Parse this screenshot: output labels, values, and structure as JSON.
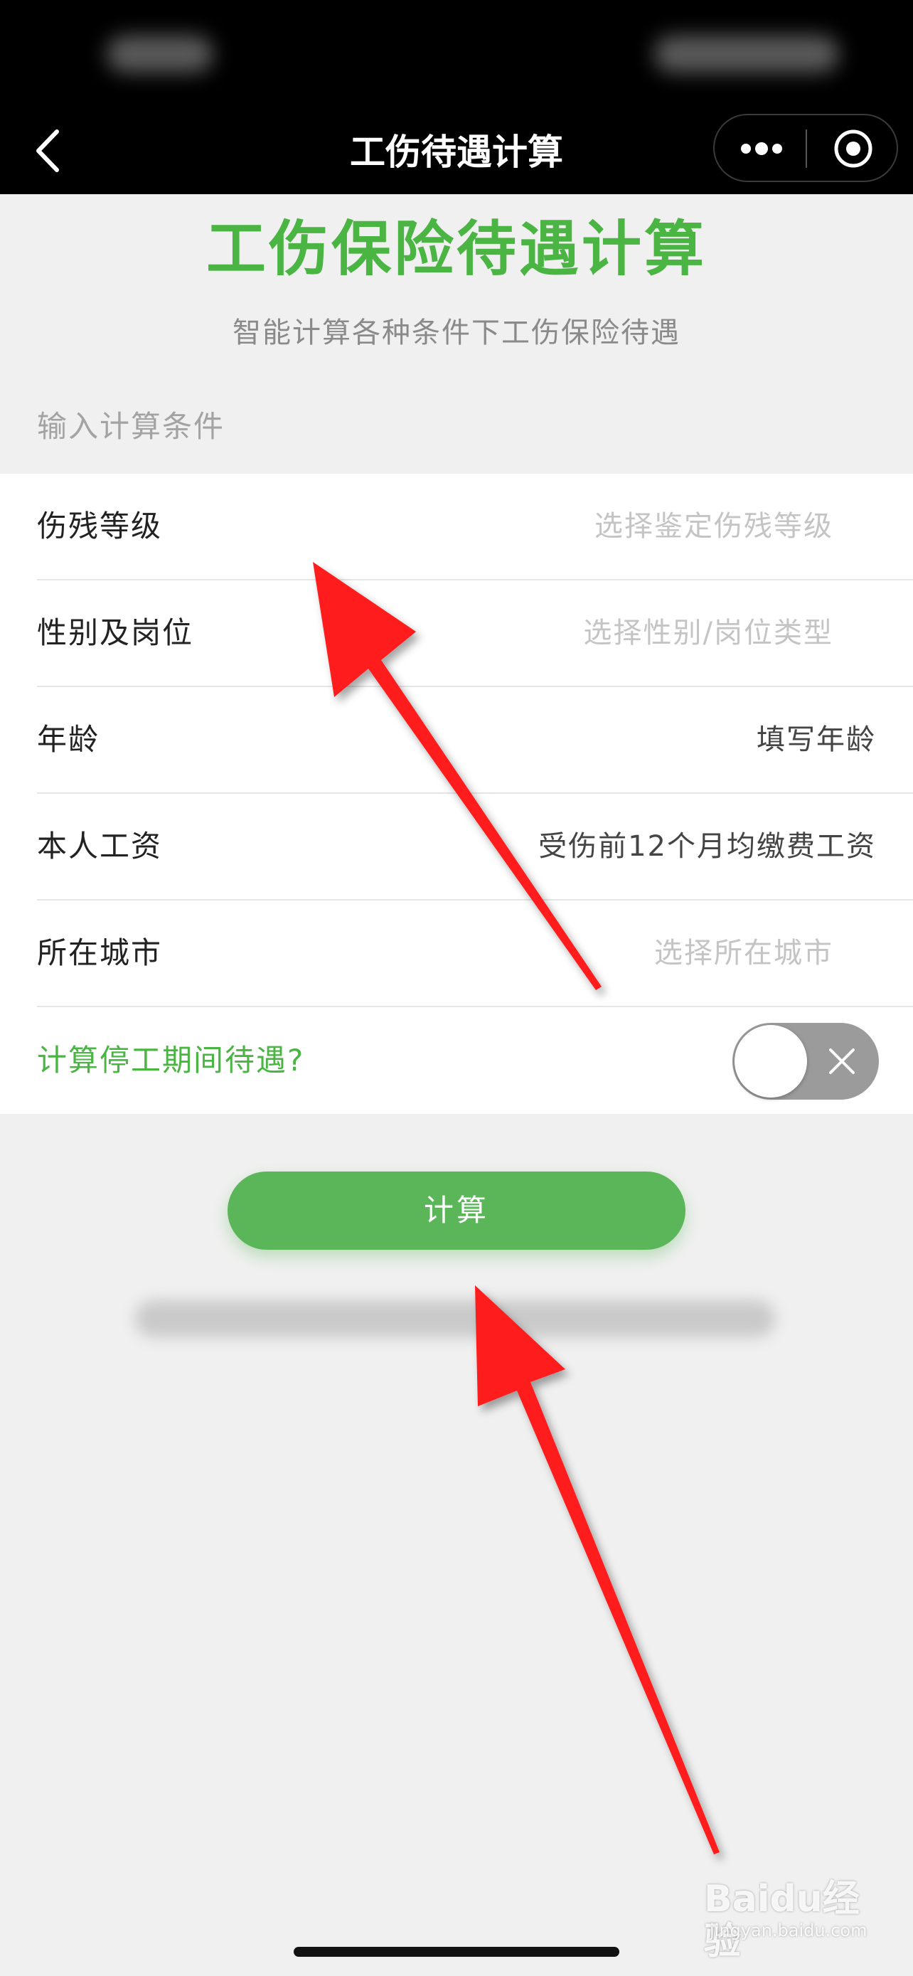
{
  "nav": {
    "title": "工伤待遇计算"
  },
  "header": {
    "title": "工伤保险待遇计算",
    "subtitle": "智能计算各种条件下工伤保险待遇"
  },
  "form": {
    "section_label": "输入计算条件",
    "rows": [
      {
        "label": "伤残等级",
        "value": "选择鉴定伤残等级"
      },
      {
        "label": "性别及岗位",
        "value": "选择性别/岗位类型"
      },
      {
        "label": "年龄",
        "value": "填写年龄"
      },
      {
        "label": "本人工资",
        "value": "受伤前12个月均缴费工资"
      },
      {
        "label": "所在城市",
        "value": "选择所在城市"
      }
    ],
    "toggle_label": "计算停工期间待遇?",
    "toggle_on": false
  },
  "actions": {
    "calculate_label": "计算"
  },
  "watermark": {
    "logo": "Baidu经验",
    "sub": "jingyan.baidu.com"
  },
  "colors": {
    "accent_green": "#4bb544",
    "button_green": "#5bb65a",
    "annotation_red": "#ff1a1a"
  }
}
